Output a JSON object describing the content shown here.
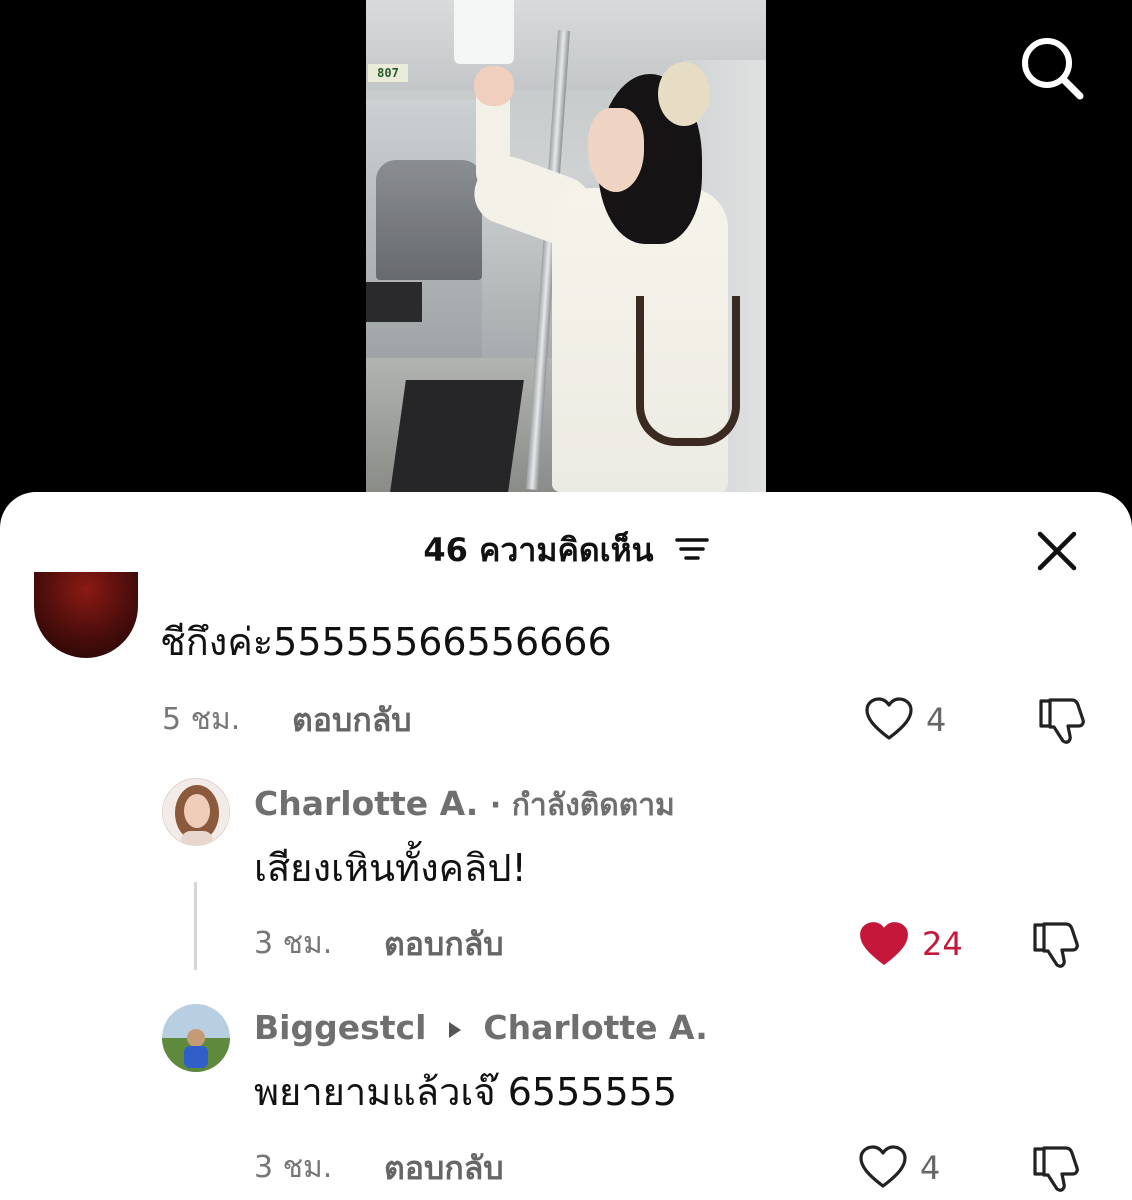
{
  "sheet": {
    "count": "46",
    "title_label": "ความคิดเห็น"
  },
  "video": {
    "car_number": "807"
  },
  "comments": [
    {
      "text": "ชีกึงค่ะ55555566556666",
      "time": "5 ชม.",
      "reply_label": "ตอบกลับ",
      "likes": "4",
      "liked": false
    },
    {
      "author": "Charlotte A.",
      "status": "· กำลังติดตาม",
      "text": "เสียงเหินทั้งคลิป!",
      "time": "3 ชม.",
      "reply_label": "ตอบกลับ",
      "likes": "24",
      "liked": true
    },
    {
      "author": "Biggestcl",
      "reply_to": "Charlotte A.",
      "text": "พยายามแล้วเจ๊ 6555555",
      "time": "3 ชม.",
      "reply_label": "ตอบกลับ",
      "likes": "4",
      "liked": false
    }
  ],
  "colors": {
    "liked_heart": "#c5173a",
    "text_primary": "#111111",
    "text_secondary": "#6f6f6f"
  },
  "icons": [
    "search-icon",
    "filter-icon",
    "close-icon",
    "heart-icon",
    "dislike-icon"
  ]
}
